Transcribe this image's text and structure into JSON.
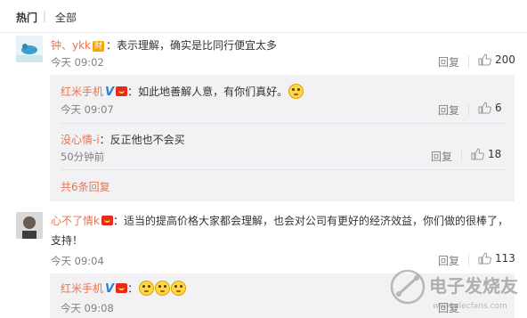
{
  "tabs": {
    "hot": "热门",
    "separator": "|",
    "all": "全部"
  },
  "comments": [
    {
      "author": "钟、ykk",
      "badge": "财",
      "text": "：表示理解，确实是比同行便宜太多",
      "time": "今天 09:02",
      "reply_label": "回复",
      "likes": "200",
      "replies": [
        {
          "author": "红米手机",
          "text": "：如此地善解人意，有你们真好。",
          "time": "今天 09:07",
          "reply_label": "回复",
          "likes": "6"
        },
        {
          "author": "没心情-i",
          "text": "：反正他也不会买",
          "time": "50分钟前",
          "reply_label": "回复",
          "likes": "18"
        }
      ],
      "more_replies": "共6条回复"
    },
    {
      "author": "心不了情k",
      "text_line1": "：适当的提高价格大家都会理解，也会对公司有更好的经济效益，你们做的很棒了，",
      "text_line2": "支持！",
      "time": "今天 09:04",
      "reply_label": "回复",
      "likes": "113",
      "replies": [
        {
          "author": "红米手机",
          "text": "：",
          "time": "今天 09:08",
          "reply_label": "回复"
        }
      ]
    }
  ],
  "watermark": {
    "text": "电子发烧友",
    "subtext": "www.elecfans.com"
  },
  "colors": {
    "name": "#eb7350",
    "v_badge": "#1f84dd",
    "sub_bg": "#f2f2f5"
  }
}
